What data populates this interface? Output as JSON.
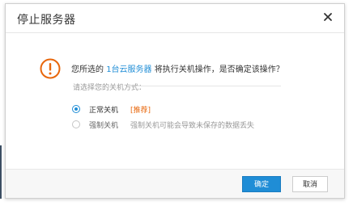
{
  "dialog": {
    "title": "停止服务器",
    "close_icon": "close-icon"
  },
  "message": {
    "icon": "warning-icon",
    "prefix": "您所选的 ",
    "link_text": "1台云服务器",
    "suffix": " 将执行关机操作，是否确定该操作？",
    "hint": "请选择您的关机方式："
  },
  "options": [
    {
      "label": "正常关机",
      "tag": "[推荐]",
      "checked": true
    },
    {
      "label": "强制关机",
      "description": "强制关机可能会导致未保存的数据丢失",
      "checked": false
    }
  ],
  "buttons": {
    "ok": "确定",
    "cancel": "取消"
  },
  "colors": {
    "accent": "#1f8dd6",
    "warning": "#e8670c",
    "recommend": "#e8670c"
  }
}
